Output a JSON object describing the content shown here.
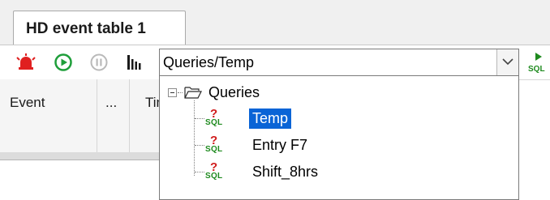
{
  "tab": {
    "title": "HD event table 1"
  },
  "combo": {
    "path": "Queries/Temp"
  },
  "grid": {
    "columns": [
      "Event",
      "...",
      "Tim"
    ]
  },
  "tree": {
    "root": "Queries",
    "items": [
      {
        "label": "Temp",
        "selected": true
      },
      {
        "label": "Entry F7",
        "selected": false
      },
      {
        "label": "Shift_8hrs",
        "selected": false
      }
    ],
    "item_icon_text": {
      "mark": "?",
      "sql": "SQL"
    }
  },
  "toolbar": {
    "icons": [
      "alarm-icon",
      "play-icon",
      "pause-icon",
      "bar-chart-icon",
      "chevron-down-icon",
      "run-sql-icon"
    ]
  },
  "colors": {
    "selection": "#0a64d6",
    "sql_green": "#1e8a1e",
    "sql_red": "#d01c1c",
    "alarm_red": "#e02020",
    "play_green": "#1e9e3a"
  }
}
